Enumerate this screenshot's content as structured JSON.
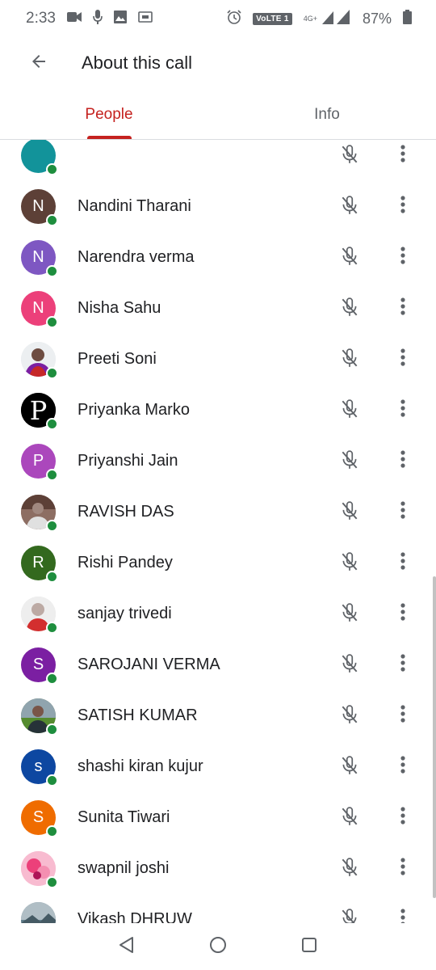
{
  "status_bar": {
    "time": "2:33",
    "network_label": "4G+",
    "volte_label": "VoLTE 1",
    "battery": "87%",
    "icons": [
      "video-icon",
      "mic-icon",
      "image-icon",
      "screen-icon",
      "alarm-icon",
      "signal-icon",
      "battery-icon"
    ]
  },
  "app_bar": {
    "title": "About this call",
    "back_icon": "arrow-back-icon"
  },
  "tabs": [
    {
      "label": "People",
      "active": true
    },
    {
      "label": "Info",
      "active": false
    }
  ],
  "colors": {
    "accent": "#c5221f",
    "online": "#1e8e3e",
    "icon_gray": "#5f6368"
  },
  "participants": [
    {
      "name": "",
      "initial": "",
      "avatar_color": "#12939a",
      "photo": false
    },
    {
      "name": "Nandini Tharani",
      "initial": "N",
      "avatar_color": "#5d4037",
      "photo": false
    },
    {
      "name": "Narendra verma",
      "initial": "N",
      "avatar_color": "#7e57c2",
      "photo": false
    },
    {
      "name": "Nisha Sahu",
      "initial": "N",
      "avatar_color": "#ec407a",
      "photo": false
    },
    {
      "name": "Preeti Soni",
      "initial": "",
      "avatar_color": "#e8eaed",
      "photo": true,
      "photo_kind": "person-red"
    },
    {
      "name": "Priyanka Marko",
      "initial": "",
      "avatar_color": "#000000",
      "photo": true,
      "photo_kind": "letter-p"
    },
    {
      "name": "Priyanshi Jain",
      "initial": "P",
      "avatar_color": "#ab47bc",
      "photo": false
    },
    {
      "name": "RAVISH DAS",
      "initial": "",
      "avatar_color": "#8d6e63",
      "photo": true,
      "photo_kind": "person-dark"
    },
    {
      "name": "Rishi Pandey",
      "initial": "R",
      "avatar_color": "#33691e",
      "photo": false
    },
    {
      "name": "sanjay trivedi",
      "initial": "",
      "avatar_color": "#e0e0e0",
      "photo": true,
      "photo_kind": "person-light"
    },
    {
      "name": "SAROJANI VERMA",
      "initial": "S",
      "avatar_color": "#7b1fa2",
      "photo": false
    },
    {
      "name": "SATISH KUMAR",
      "initial": "",
      "avatar_color": "#4e6b3a",
      "photo": true,
      "photo_kind": "person-outdoor"
    },
    {
      "name": "shashi kiran kujur",
      "initial": "s",
      "avatar_color": "#0d47a1",
      "photo": false
    },
    {
      "name": "Sunita Tiwari",
      "initial": "S",
      "avatar_color": "#ef6c00",
      "photo": false
    },
    {
      "name": "swapnil joshi",
      "initial": "",
      "avatar_color": "#f8bbd0",
      "photo": true,
      "photo_kind": "pink-flower"
    },
    {
      "name": "Vikash DHRUW",
      "initial": "",
      "avatar_color": "#78909c",
      "photo": true,
      "photo_kind": "landscape"
    }
  ],
  "row_icons": {
    "mic": "mic-off-icon",
    "more": "more-vert-icon"
  },
  "nav_bar": {
    "icons": [
      "back-triangle-icon",
      "home-circle-icon",
      "recents-square-icon"
    ]
  }
}
